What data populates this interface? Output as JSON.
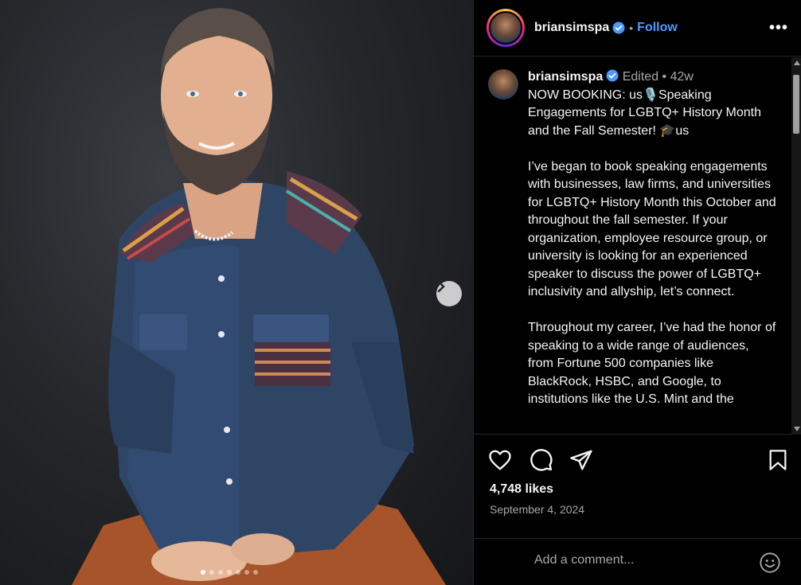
{
  "post": {
    "username": "briansimspa",
    "follow_label": "Follow",
    "more_label": "•••",
    "caption_meta": "Edited • 42w",
    "caption_paragraphs": [
      "NOW BOOKING: us🎙️Speaking Engagements for LGBTQ+ History Month and the Fall Semester! 🎓us",
      "I’ve began to book speaking engagements with businesses, law firms, and universities for LGBTQ+ History Month this October and throughout the fall semester. If your organization, employee resource group, or university is looking for an experienced speaker to discuss the power of LGBTQ+ inclusivity and allyship, let’s connect.",
      "Throughout my career, I’ve had the honor of speaking to a wide range of audiences, from Fortune 500 companies like BlackRock, HSBC, and Google, to institutions like the U.S. Mint and the"
    ],
    "likes": "4,748 likes",
    "date": "September 4, 2024",
    "comment_placeholder": "Add a comment...",
    "carousel": {
      "current": 1,
      "total": 7
    }
  },
  "icons": [
    "verified-badge-icon",
    "chevron-right-icon",
    "heart-icon",
    "comment-icon",
    "share-icon",
    "bookmark-icon",
    "emoji-icon"
  ],
  "colors": {
    "accent": "#4a9bff",
    "background": "#000000",
    "muted": "#a8a8a8"
  }
}
